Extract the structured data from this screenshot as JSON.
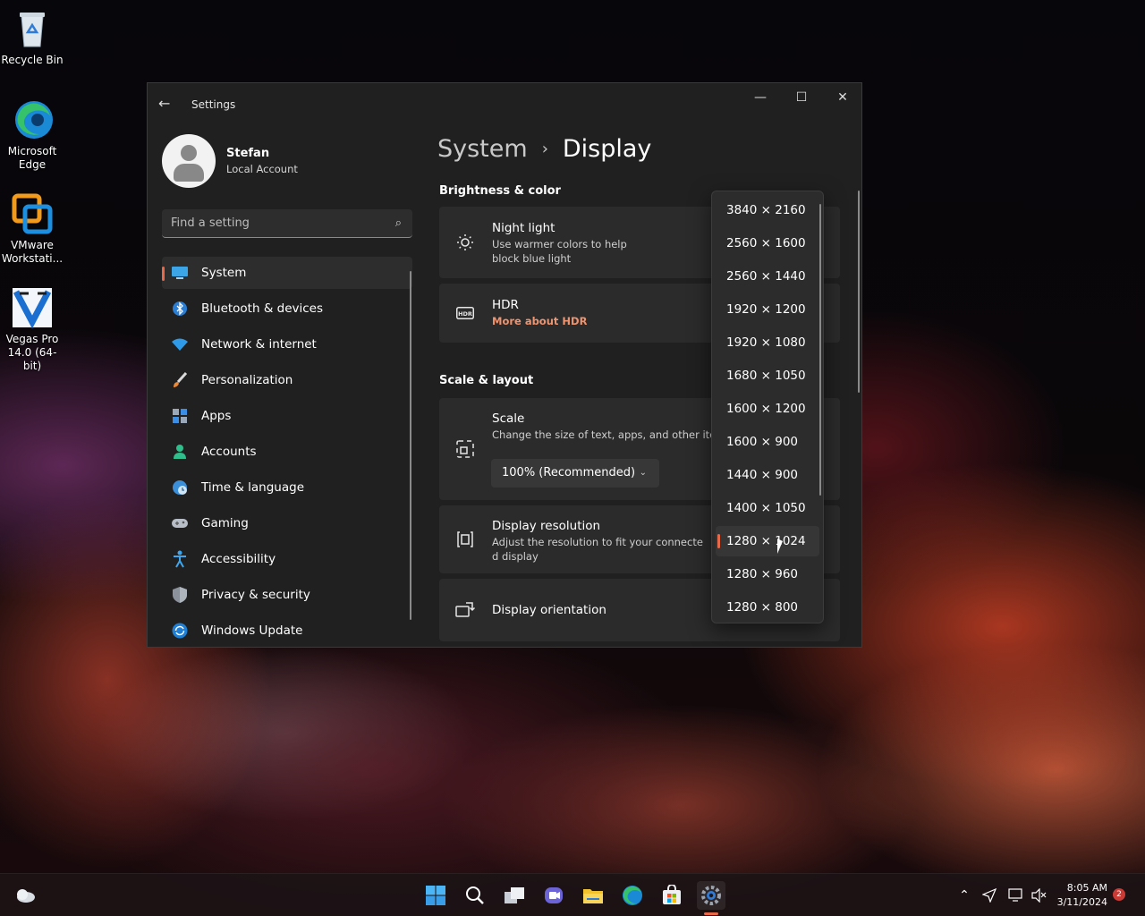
{
  "desktop": {
    "icons": [
      {
        "label": "Recycle Bin",
        "icon": "recycle-bin-icon"
      },
      {
        "label": "Microsoft Edge",
        "icon": "edge-icon"
      },
      {
        "label": "VMware Workstati...",
        "icon": "vmware-icon"
      },
      {
        "label": "Vegas Pro 14.0 (64-bit)",
        "icon": "vegas-pro-icon"
      }
    ]
  },
  "window": {
    "title": "Settings",
    "controls": {
      "minimize": "—",
      "maximize": "☐",
      "close": "✕"
    }
  },
  "profile": {
    "name": "Stefan",
    "account_type": "Local Account"
  },
  "search": {
    "placeholder": "Find a setting"
  },
  "sidebar": {
    "items": [
      {
        "label": "System",
        "icon": "system-icon",
        "active": true
      },
      {
        "label": "Bluetooth & devices",
        "icon": "bluetooth-icon"
      },
      {
        "label": "Network & internet",
        "icon": "wifi-icon"
      },
      {
        "label": "Personalization",
        "icon": "brush-icon"
      },
      {
        "label": "Apps",
        "icon": "apps-icon"
      },
      {
        "label": "Accounts",
        "icon": "person-icon"
      },
      {
        "label": "Time & language",
        "icon": "globe-clock-icon"
      },
      {
        "label": "Gaming",
        "icon": "gamepad-icon"
      },
      {
        "label": "Accessibility",
        "icon": "accessibility-icon"
      },
      {
        "label": "Privacy & security",
        "icon": "shield-icon"
      },
      {
        "label": "Windows Update",
        "icon": "update-icon"
      }
    ]
  },
  "breadcrumb": {
    "parent": "System",
    "separator": "›",
    "current": "Display"
  },
  "sections": {
    "brightness": "Brightness & color",
    "scale_layout": "Scale & layout"
  },
  "cards": {
    "night_light": {
      "title": "Night light",
      "desc_line1": "Use warmer colors to help",
      "desc_line2": "block blue light"
    },
    "hdr": {
      "title": "HDR",
      "link": "More about HDR"
    },
    "scale": {
      "title": "Scale",
      "desc": "Change the size of text, apps, and other items",
      "value": "100% (Recommended)"
    },
    "resolution": {
      "title": "Display resolution",
      "desc_line1": "Adjust the resolution to fit your connecte",
      "desc_line2": "d display"
    },
    "orientation": {
      "title": "Display orientation"
    }
  },
  "resolution_dropdown": {
    "options": [
      "3840 × 2160",
      "2560 × 1600",
      "2560 × 1440",
      "1920 × 1200",
      "1920 × 1080",
      "1680 × 1050",
      "1600 × 1200",
      "1600 × 900",
      "1440 × 900",
      "1400 × 1050",
      "1280 × 1024",
      "1280 × 960",
      "1280 × 800"
    ],
    "selected": "1280 × 1024"
  },
  "taskbar": {
    "icons": [
      "weather-icon",
      "start-icon",
      "search-icon",
      "task-view-icon",
      "teams-chat-icon",
      "file-explorer-icon",
      "edge-icon",
      "store-icon",
      "settings-icon"
    ],
    "time": "8:05 AM",
    "date": "3/11/2024",
    "notification_count": "2"
  },
  "colors": {
    "accent": "#e8694a",
    "window_bg": "#202020",
    "card_bg": "#2b2b2b",
    "link": "#ee9470"
  }
}
